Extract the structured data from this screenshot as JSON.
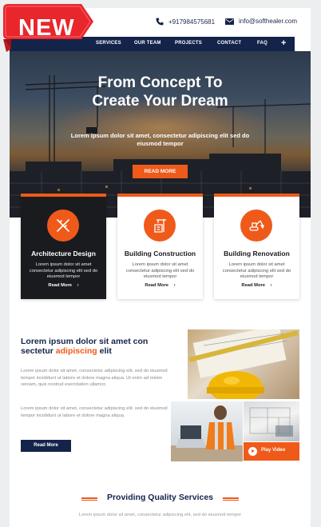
{
  "ribbon": {
    "label": "NEW"
  },
  "topbar": {
    "phone": "+917984575681",
    "email": "info@softhealer.com"
  },
  "nav": {
    "items": [
      "SERVICES",
      "OUR TEAM",
      "PROJECTS",
      "CONTACT",
      "FAQ"
    ],
    "plus": "+"
  },
  "hero": {
    "title_line1": "From Concept To",
    "title_line2": "Create Your Dream",
    "subtitle": "Lorem ipsum dolor sit amet, consectetur adipiscing elit sed do eiusmod tempor",
    "button": "READ MORE"
  },
  "services": [
    {
      "title": "Architecture Design",
      "desc": "Lorem ipsum dolor sit amet consectetur adipiscing elit sed do eiusmod tempor",
      "more": "Read More",
      "arrow": "›",
      "icon": "pencil-ruler-icon"
    },
    {
      "title": "Building Construction",
      "desc": "Lorem ipsum dolor sit amet consectetur adipiscing elit sed do eiusmod tempor",
      "more": "Read More",
      "arrow": "›",
      "icon": "crane-building-icon"
    },
    {
      "title": "Building Renovation",
      "desc": "Lorem ipsum dolor sit amet consectetur adipiscing elit sed do eiusmod tempor",
      "more": "Read More",
      "arrow": "›",
      "icon": "excavator-icon"
    }
  ],
  "about": {
    "title_part1": "Lorem ipsum dolor sit amet con sectetur",
    "title_highlight": "adipiscing",
    "title_part2": "elit",
    "para1": "Lorem ipsum dolor sit amet, consectetur adipiscing elit, sed do eiusmod tempor incididunt ut labore et dolore magna aliqua. Ut enim ad minim veniam, quis nostrud exercitation ullamco",
    "para2": "Lorem ipsum dolor sit amet, consectetur adipiscing elit, sed do eiusmod tempor incididunt ut labore et dolore magna aliqua.",
    "button": "Read More",
    "play_label": "Play Video"
  },
  "providing": {
    "title": "Providing Quality Services",
    "subtitle": "Lorem ipsum dolor sit amet, consectetur adipiscing elit, sed do eiusmod tempor"
  },
  "colors": {
    "accent": "#ef5a1a",
    "navy": "#13234a",
    "dark_card": "#1a1b1f",
    "ribbon": "#e8262c"
  }
}
